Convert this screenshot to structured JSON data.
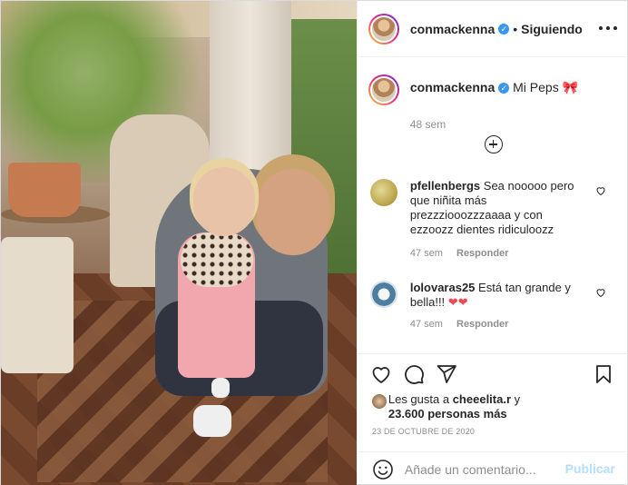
{
  "header": {
    "username": "conmackenna",
    "separator": "•",
    "follow_state": "Siguiendo"
  },
  "caption": {
    "username": "conmackenna",
    "text": "Mi Peps",
    "emoji": "🎀",
    "time": "48 sem"
  },
  "comments": [
    {
      "username": "pfellenbergs",
      "text": "Sea nooooo pero que niñita más prezzziooozzzaaaa y con ezzoozz dientes ridiculoozz",
      "time": "47 sem",
      "reply_label": "Responder"
    },
    {
      "username": "lolovaras25",
      "text": "Está tan grande y bella!!!",
      "emoji": "❤❤",
      "time": "47 sem",
      "reply_label": "Responder"
    }
  ],
  "likes": {
    "prefix": "Les gusta a",
    "user": "cheeelita.r",
    "joiner": "y",
    "count": "23.600 personas más"
  },
  "date": "23 DE OCTUBRE DE 2020",
  "add_comment": {
    "placeholder": "Añade un comentario...",
    "publish_label": "Publicar"
  },
  "icons": {
    "verified": "verified-badge-icon",
    "more": "more-options-icon",
    "load_more": "add-circle-icon",
    "like": "heart-icon",
    "comment": "comment-icon",
    "share": "send-icon",
    "save": "bookmark-icon",
    "emoji": "emoji-icon"
  },
  "colors": {
    "verified": "#3897f0",
    "publish_disabled": "#b2dffc",
    "heart_red": "#ed4956",
    "muted_text": "#8e8e8e"
  }
}
